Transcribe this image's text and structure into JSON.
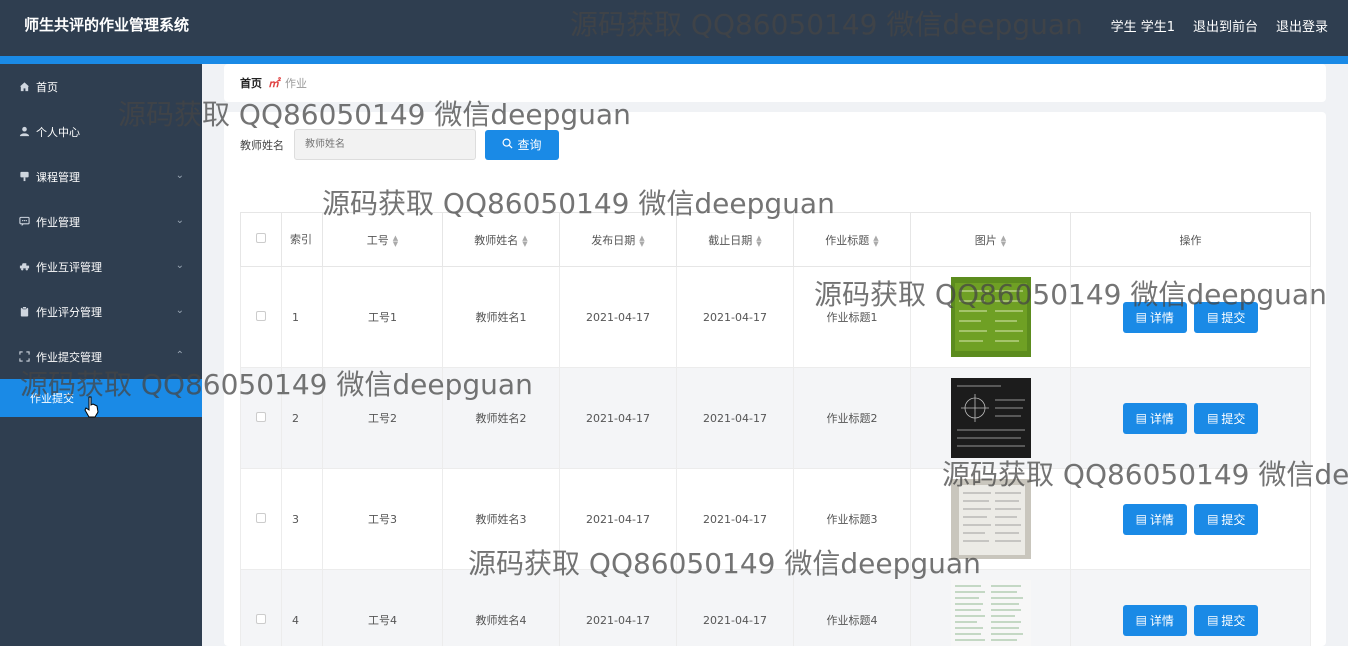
{
  "header": {
    "title": "师生共评的作业管理系统",
    "user": "学生 学生1",
    "front_link": "退出到前台",
    "logout": "退出登录"
  },
  "sidebar": {
    "items": [
      {
        "label": "首页",
        "icon": "home-icon"
      },
      {
        "label": "个人中心",
        "icon": "user-icon"
      },
      {
        "label": "课程管理",
        "icon": "course-icon"
      },
      {
        "label": "作业管理",
        "icon": "message-icon"
      },
      {
        "label": "作业互评管理",
        "icon": "car-icon"
      },
      {
        "label": "作业评分管理",
        "icon": "clipboard-icon"
      },
      {
        "label": "作业提交管理",
        "icon": "fullscreen-icon"
      }
    ],
    "active_sub": "作业提交"
  },
  "breadcrumb": {
    "home": "首页",
    "separator": "㎡",
    "current": "作业"
  },
  "search": {
    "label": "教师姓名",
    "placeholder": "教师姓名",
    "button": "查询"
  },
  "table": {
    "headers": [
      "索引",
      "工号",
      "教师姓名",
      "发布日期",
      "截止日期",
      "作业标题",
      "图片",
      "操作"
    ],
    "rows": [
      {
        "index": "1",
        "job_no": "工号1",
        "teacher": "教师姓名1",
        "publish": "2021-04-17",
        "deadline": "2021-04-17",
        "title": "作业标题1"
      },
      {
        "index": "2",
        "job_no": "工号2",
        "teacher": "教师姓名2",
        "publish": "2021-04-17",
        "deadline": "2021-04-17",
        "title": "作业标题2"
      },
      {
        "index": "3",
        "job_no": "工号3",
        "teacher": "教师姓名3",
        "publish": "2021-04-17",
        "deadline": "2021-04-17",
        "title": "作业标题3"
      },
      {
        "index": "4",
        "job_no": "工号4",
        "teacher": "教师姓名4",
        "publish": "2021-04-17",
        "deadline": "2021-04-17",
        "title": "作业标题4"
      }
    ],
    "detail_label": "详情",
    "submit_label": "提交"
  },
  "watermark": "源码获取 QQ86050149 微信deepguan",
  "colors": {
    "header_bg": "#2f3e50",
    "accent": "#1a8ae6",
    "page_bg": "#f0f2f5"
  }
}
